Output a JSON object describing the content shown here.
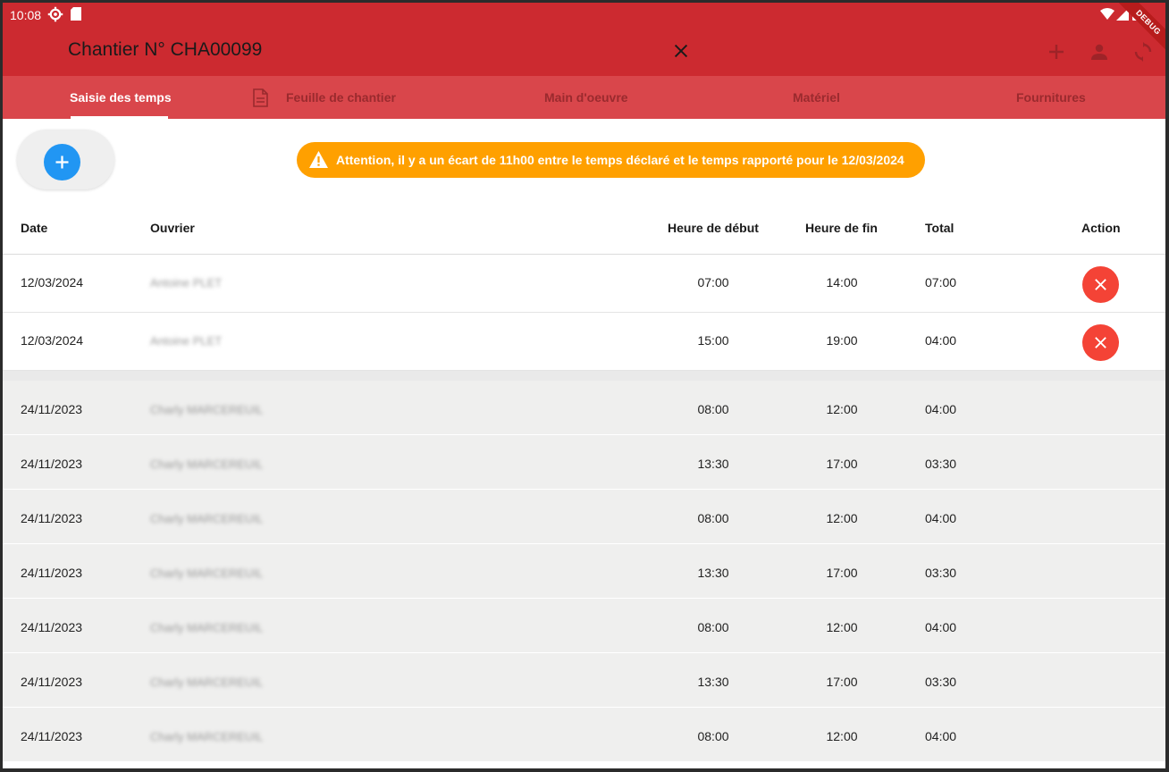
{
  "status_bar": {
    "time": "10:08",
    "debug_label": "DEBUG",
    "icons": [
      "gear-icon",
      "sd-card-icon",
      "wifi-icon",
      "signal-icon",
      "battery-icon"
    ]
  },
  "app_bar": {
    "title": "Chantier N° CHA00099",
    "actions": [
      "close-icon",
      "add-icon",
      "person-icon",
      "sync-icon"
    ],
    "color": "#cc2a30"
  },
  "tabs": [
    {
      "label": "Saisie des temps",
      "active": true
    },
    {
      "label": "Feuille de chantier",
      "active": false,
      "icon": "document-icon"
    },
    {
      "label": "Main d'oeuvre",
      "active": false
    },
    {
      "label": "Matériel",
      "active": false
    },
    {
      "label": "Fournitures",
      "active": false
    }
  ],
  "warning": {
    "text": "Attention, il y a un écart de 11h00 entre le temps déclaré et le temps rapporté pour le 12/03/2024",
    "color": "#ffa000"
  },
  "table": {
    "headers": [
      "Date",
      "Ouvrier",
      "Heure de début",
      "Heure de fin",
      "Total",
      "Action"
    ],
    "rows": [
      {
        "date": "12/03/2024",
        "ouvrier": "Antoine PLET",
        "debut": "07:00",
        "fin": "14:00",
        "total": "07:00",
        "deletable": true
      },
      {
        "date": "12/03/2024",
        "ouvrier": "Antoine PLET",
        "debut": "15:00",
        "fin": "19:00",
        "total": "04:00",
        "deletable": true
      },
      {
        "date": "24/11/2023",
        "ouvrier": "Charly MARCEREUIL",
        "debut": "08:00",
        "fin": "12:00",
        "total": "04:00",
        "deletable": false
      },
      {
        "date": "24/11/2023",
        "ouvrier": "Charly MARCEREUIL",
        "debut": "13:30",
        "fin": "17:00",
        "total": "03:30",
        "deletable": false
      },
      {
        "date": "24/11/2023",
        "ouvrier": "Charly MARCEREUIL",
        "debut": "08:00",
        "fin": "12:00",
        "total": "04:00",
        "deletable": false
      },
      {
        "date": "24/11/2023",
        "ouvrier": "Charly MARCEREUIL",
        "debut": "13:30",
        "fin": "17:00",
        "total": "03:30",
        "deletable": false
      },
      {
        "date": "24/11/2023",
        "ouvrier": "Charly MARCEREUIL",
        "debut": "08:00",
        "fin": "12:00",
        "total": "04:00",
        "deletable": false
      },
      {
        "date": "24/11/2023",
        "ouvrier": "Charly MARCEREUIL",
        "debut": "13:30",
        "fin": "17:00",
        "total": "03:30",
        "deletable": false
      },
      {
        "date": "24/11/2023",
        "ouvrier": "Charly MARCEREUIL",
        "debut": "08:00",
        "fin": "12:00",
        "total": "04:00",
        "deletable": false
      }
    ]
  }
}
